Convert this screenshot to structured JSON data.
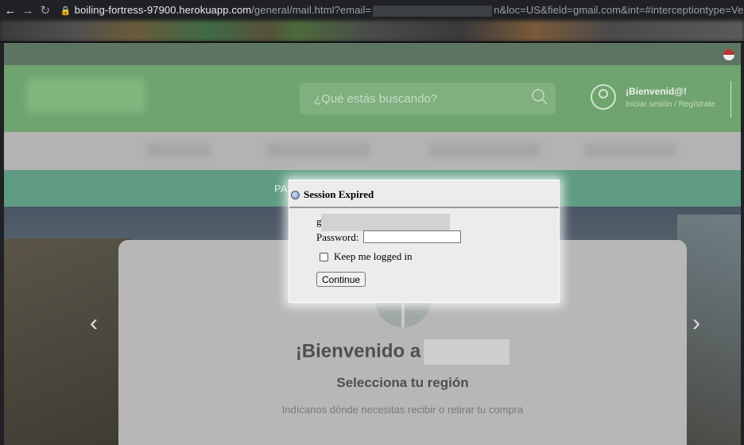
{
  "browser": {
    "url_host": "boiling-fortress-97900.herokuapp.com",
    "url_path": "/general/mail.html?email=",
    "url_tail": "n&loc=US&field=gmail.com&int=#interceptiontype=Ver"
  },
  "header": {
    "search_placeholder": "¿Qué estás buscando?",
    "welcome": "¡Bienvenid@!",
    "login": "Iniciar sesión / Regístrate"
  },
  "promo": {
    "text": "PA"
  },
  "hero": {
    "welcome": "¡Bienvenido a",
    "select_region": "Selecciona tu región",
    "hint": "Indícanos dónde necesitas recibir o retirar tu compra"
  },
  "modal": {
    "title": "Session Expired",
    "user_prefix": "g",
    "password_label": "Password:",
    "keep_logged": "Keep me logged in",
    "continue": "Continue"
  }
}
